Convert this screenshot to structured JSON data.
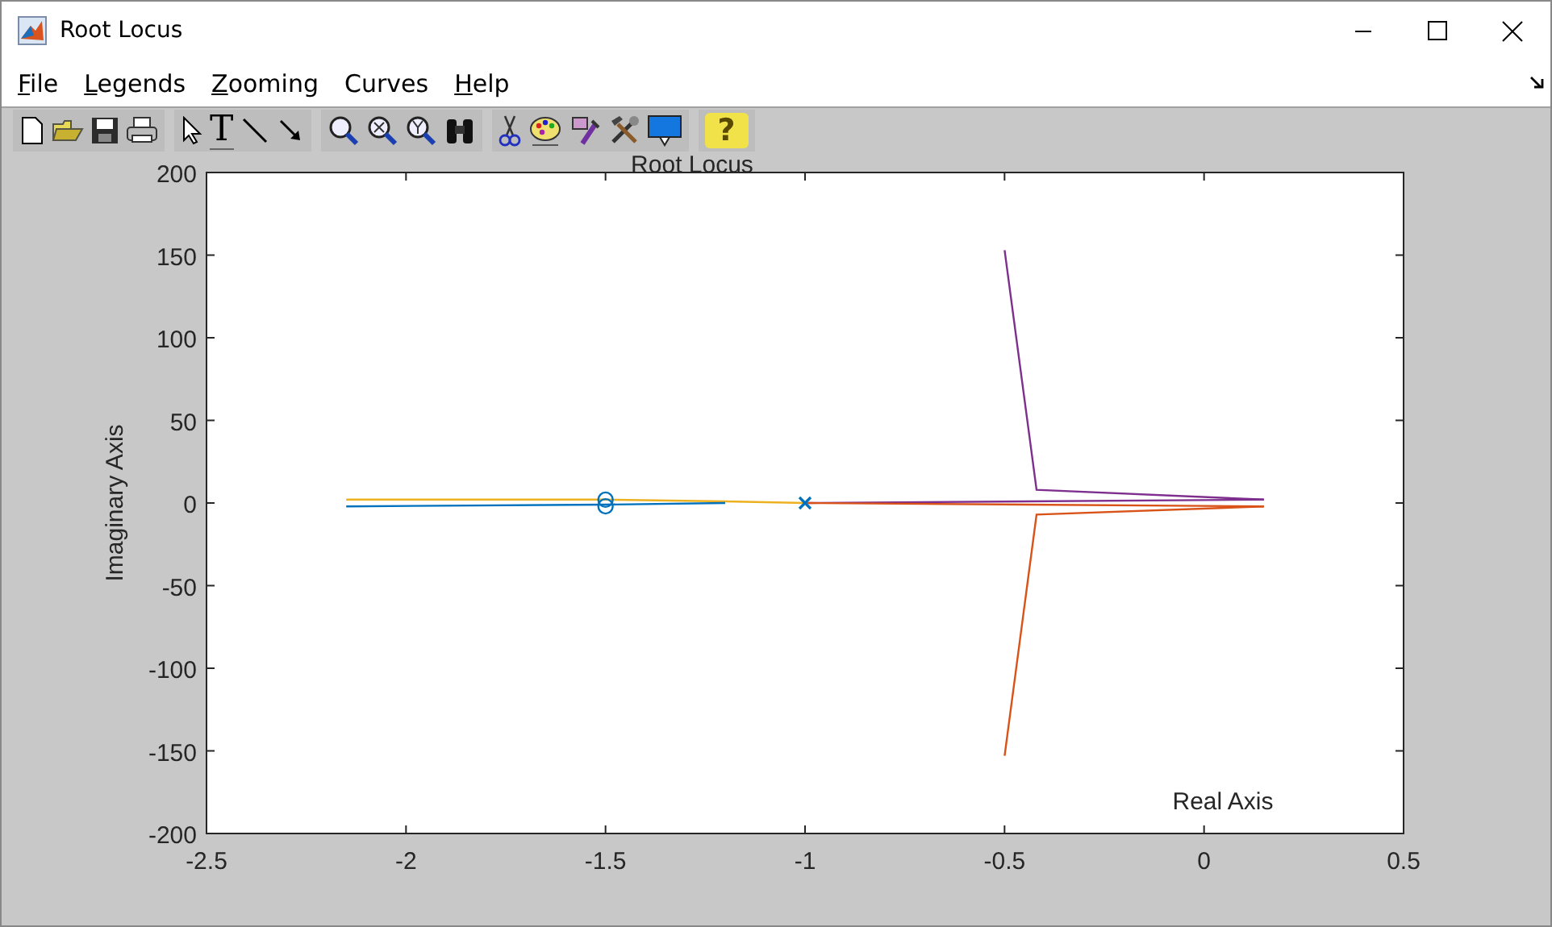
{
  "window": {
    "title": "Root Locus"
  },
  "menu": [
    {
      "label": "File",
      "mnemonic": true
    },
    {
      "label": "Legends",
      "mnemonic": true
    },
    {
      "label": "Zooming",
      "mnemonic": true
    },
    {
      "label": "Curves",
      "mnemonic": false
    },
    {
      "label": "Help",
      "mnemonic": true
    }
  ],
  "toolbar": {
    "text_tool": "T",
    "help": "?"
  },
  "plot": {
    "chart_data": {
      "type": "line",
      "title": "Root Locus",
      "xlabel": "Real Axis",
      "ylabel": "Imaginary Axis",
      "xlim": [
        -2.5,
        0.5
      ],
      "ylim": [
        -200,
        200
      ],
      "xticks": [
        {
          "value": -2.5,
          "label": "-2.5"
        },
        {
          "value": -2,
          "label": "-2"
        },
        {
          "value": -1.5,
          "label": "-1.5"
        },
        {
          "value": -1,
          "label": "-1"
        },
        {
          "value": -0.5,
          "label": "-0.5"
        },
        {
          "value": 0,
          "label": "0"
        },
        {
          "value": 0.5,
          "label": "0.5"
        }
      ],
      "yticks": [
        {
          "value": -200,
          "label": "-200"
        },
        {
          "value": -150,
          "label": "-150"
        },
        {
          "value": -100,
          "label": "-100"
        },
        {
          "value": -50,
          "label": "-50"
        },
        {
          "value": 0,
          "label": "0"
        },
        {
          "value": 50,
          "label": "50"
        },
        {
          "value": 100,
          "label": "100"
        },
        {
          "value": 150,
          "label": "150"
        },
        {
          "value": 200,
          "label": "200"
        }
      ],
      "x": [
        -2.15,
        -1.5,
        -1.2,
        -1,
        -0.5,
        -0.42,
        0.15
      ],
      "series": [
        {
          "color": "#edb120",
          "values": [
            2,
            2,
            1,
            0,
            null,
            null,
            null
          ]
        },
        {
          "color": "#0072bd",
          "values": [
            -2,
            -1,
            0,
            null,
            null,
            null,
            null
          ]
        },
        {
          "color": "#7e2f8e",
          "values": [
            null,
            null,
            null,
            0,
            null,
            null,
            2
          ]
        },
        {
          "color": "#d95319",
          "values": [
            null,
            null,
            null,
            0,
            null,
            null,
            -2
          ]
        },
        {
          "color": "#7e2f8e",
          "values": [
            null,
            null,
            null,
            null,
            153,
            8,
            2
          ]
        },
        {
          "color": "#d95319",
          "values": [
            null,
            null,
            null,
            null,
            -153,
            -7,
            -2
          ]
        },
        {
          "color": "#0072bd",
          "marker": "x",
          "values": [
            null,
            null,
            null,
            0,
            null,
            null,
            null
          ]
        },
        {
          "color": "#0072bd",
          "marker": "o",
          "values": [
            null,
            2,
            null,
            null,
            null,
            null,
            null
          ]
        },
        {
          "color": "#0072bd",
          "marker": "o",
          "values": [
            null,
            -2,
            null,
            null,
            null,
            null,
            null
          ]
        }
      ]
    }
  }
}
